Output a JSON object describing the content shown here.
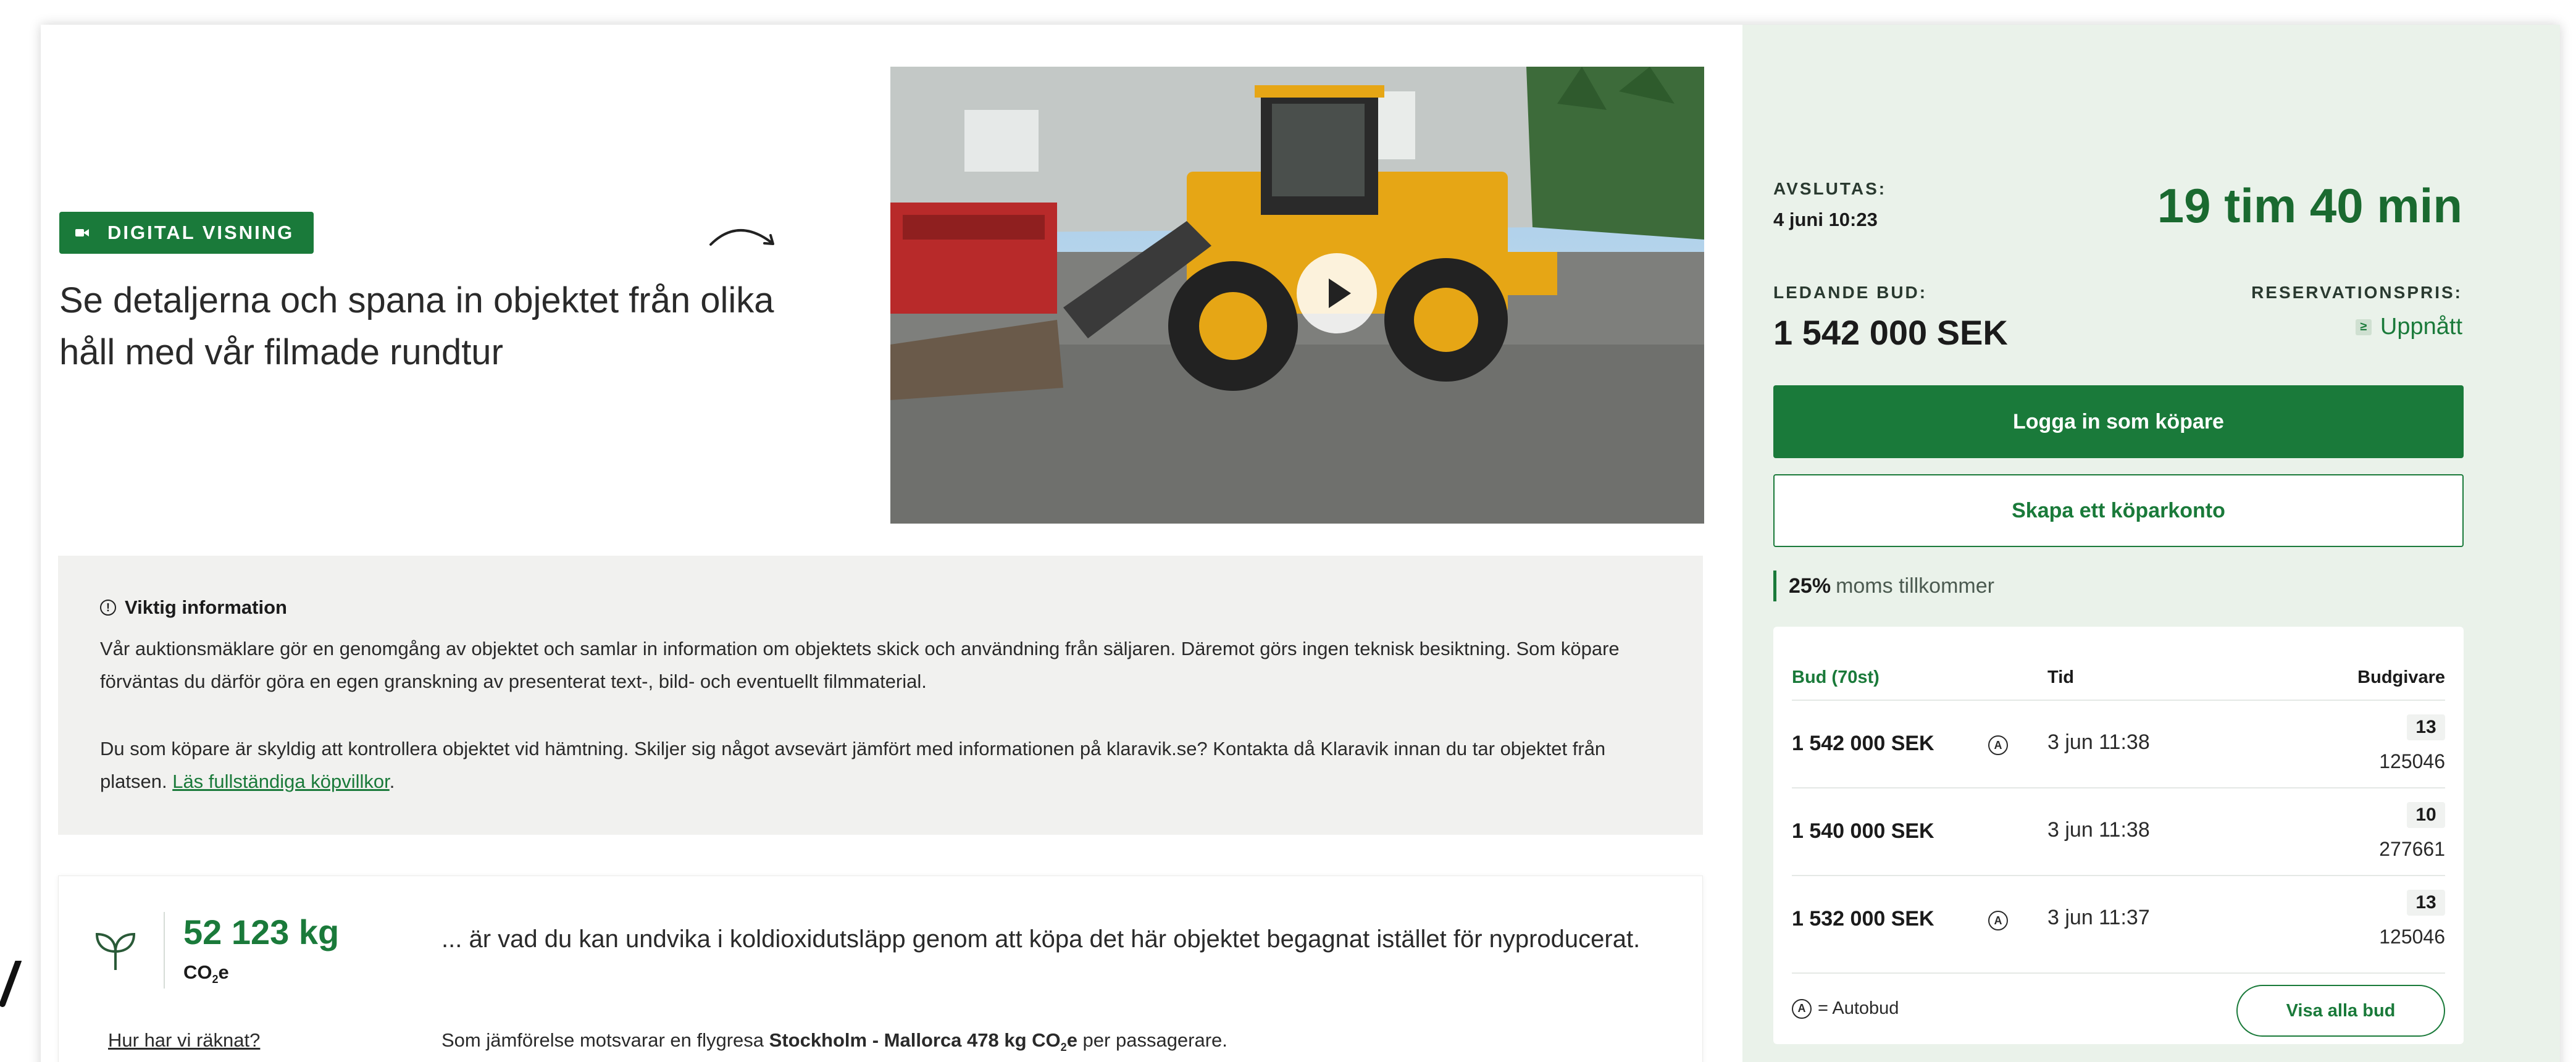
{
  "digital_visning": {
    "badge": "DIGITAL VISNING",
    "headline": "Se detaljerna och spana in objektet från olika håll med vår filmade rundtur"
  },
  "video": {
    "play_icon": "play-icon"
  },
  "important_info": {
    "title": "Viktig information",
    "paragraph1": "Vår auktionsmäklare gör en genomgång av objektet och samlar in information om objektets skick och användning från säljaren. Däremot görs ingen teknisk besiktning. Som köpare förväntas du därför göra en egen granskning av presenterat text-, bild- och eventuellt filmmaterial.",
    "paragraph2": "Du som köpare är skyldig att kontrollera objektet vid hämtning. Skiljer sig något avsevärt jämfört med informationen på klaravik.se? Kontakta då Klaravik innan du tar objektet från platsen.",
    "link": "Läs fullständiga köpvillkor",
    "link_suffix": "."
  },
  "co2": {
    "value": "52 123 kg",
    "unit_main": "CO",
    "unit_sub": "2",
    "unit_tail": "e",
    "text": "... är vad du kan undvika i koldioxidutsläpp genom att köpa det här objektet begagnat istället för nyproducerat.",
    "how_link": "Hur har vi räknat?",
    "compare_prefix": "Som jämförelse motsvarar en flygresa ",
    "compare_bold": "Stockholm - Mallorca 478 kg CO",
    "compare_sub": "2",
    "compare_tail": "e",
    "compare_suffix": " per passagerare."
  },
  "auction": {
    "ends_label": "AVSLUTAS:",
    "ends_date": "4 juni 10:23",
    "countdown": "19 tim 40 min",
    "lead_label": "LEDANDE BUD:",
    "lead_value": "1 542 000 SEK",
    "reserve_label": "RESERVATIONSPRIS:",
    "reserve_icon": "≥",
    "reserve_value": "Uppnått",
    "login_button": "Logga in som köpare",
    "create_button": "Skapa ett köparkonto",
    "vat_bold": "25%",
    "vat_text": "moms tillkommer"
  },
  "bids": {
    "headers": {
      "bid": "Bud (70st)",
      "time": "Tid",
      "bidder": "Budgivare"
    },
    "rows": [
      {
        "amount": "1 542 000 SEK",
        "auto": "A",
        "time": "3 jun 11:38",
        "count": "13",
        "bidder": "125046"
      },
      {
        "amount": "1 540 000 SEK",
        "auto": "",
        "time": "3 jun 11:38",
        "count": "10",
        "bidder": "277661"
      },
      {
        "amount": "1 532 000 SEK",
        "auto": "A",
        "time": "3 jun 11:37",
        "count": "13",
        "bidder": "125046"
      }
    ],
    "legend_symbol": "A",
    "legend_text": "= Autobud",
    "show_all_button": "Visa alla bud"
  },
  "colors": {
    "brand_green": "#1a7a3a",
    "sidebar_bg": "#eaf2ea",
    "info_bg": "#f1f1ef"
  }
}
